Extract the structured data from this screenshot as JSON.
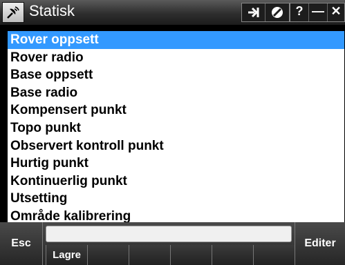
{
  "window": {
    "title": "Statisk",
    "app_icon": "antenna-icon",
    "toolbar_icons": [
      "connect-icon",
      "satellite-status-icon",
      "help-icon",
      "minimize-icon",
      "close-icon"
    ],
    "help_label": "?",
    "minimize_label": "—",
    "close_label": "✕"
  },
  "list": {
    "selected_index": 0,
    "items": [
      "Rover oppsett",
      "Rover radio",
      "Base oppsett",
      "Base radio",
      "Kompensert punkt",
      "Topo punkt",
      "Observert kontroll punkt",
      "Hurtig punkt",
      "Kontinuerlig punkt",
      "Utsetting",
      "Område kalibrering"
    ]
  },
  "footer": {
    "esc_label": "Esc",
    "edit_label": "Editer",
    "status_text": "",
    "softkeys": [
      "Lagre",
      "",
      "",
      "",
      "",
      ""
    ]
  },
  "colors": {
    "selection": "#3399ff",
    "titlebar": "#2e2e2e",
    "list_background": "#ffffff"
  }
}
